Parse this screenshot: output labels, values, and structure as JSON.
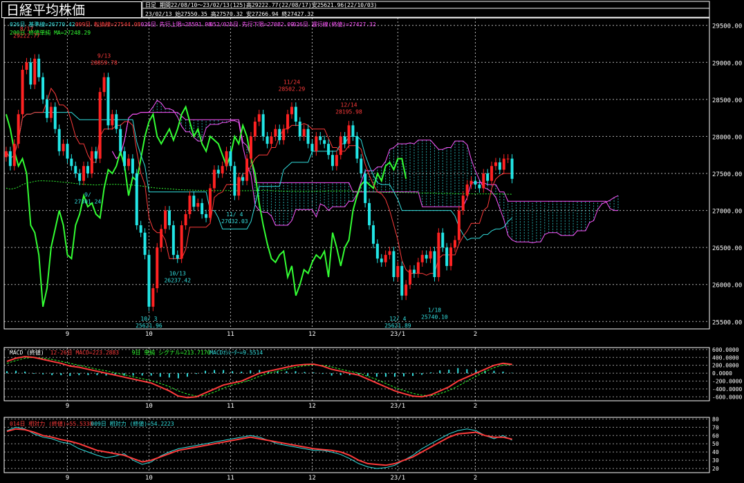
{
  "header": {
    "title": "日経平均株価",
    "line1": "日足  期間22/08/10～23/02/13(125)高29222.77(22/08/17)安25621.96(22/10/03)",
    "line2": "23/02/13      始27550.35 高27570.32 安27266.94 終27427.32"
  },
  "legend_main": [
    {
      "text": "026日 基準線=26770.42",
      "color": "#33e0e0"
    },
    {
      "text": "009日 転換線=27544.08",
      "color": "#ff3b3b"
    },
    {
      "text": "026日 先行上限=28591.98",
      "color": "#ff55ff"
    },
    {
      "text": "052/026日 先行下限=27082.09",
      "color": "#ff55ff"
    },
    {
      "text": "026日 遅行線(終値)=27427.32",
      "color": "#ff55ff"
    },
    {
      "text": "200日 終値単純 MA=27248.29",
      "color": "#33ff33"
    }
  ],
  "legend_macd": [
    {
      "text": "MACD (終値)",
      "color": "#ffffff"
    },
    {
      "text": "12-26日 MACD=223.2883",
      "color": "#ff3b3b"
    },
    {
      "text": "9日 単純 シグナル=213.7170",
      "color": "#33ff33"
    },
    {
      "text": "MACDｵｼﾚｰﾀｰ=9.5514",
      "color": "#33e0e0"
    }
  ],
  "legend_rsi": [
    {
      "text": "014日 相対力 (終値)=55.5338",
      "color": "#ff3b3b"
    },
    {
      "text": "009日 相対力 (終値)=54.2223",
      "color": "#33e0e0"
    }
  ],
  "x_labels": [
    {
      "label": "9",
      "idx": 15
    },
    {
      "label": "10",
      "idx": 35
    },
    {
      "label": "11",
      "idx": 55
    },
    {
      "label": "12",
      "idx": 75
    },
    {
      "label": "23/1",
      "idx": 96
    },
    {
      "label": "2",
      "idx": 115
    }
  ],
  "annotations": [
    {
      "label": "8/17",
      "value": "29222.77",
      "color": "#ff3b3b",
      "idx": 5,
      "price": 29222.77,
      "pos": "above"
    },
    {
      "label": "9/13",
      "value": "28859.78",
      "color": "#ff3b3b",
      "idx": 24,
      "price": 28859.78,
      "pos": "above"
    },
    {
      "label": "11/24",
      "value": "28502.29",
      "color": "#ff3b3b",
      "idx": 70,
      "price": 28502.29,
      "pos": "above"
    },
    {
      "label": "12/14",
      "value": "28195.98",
      "color": "#ff3b3b",
      "idx": 84,
      "price": 28195.98,
      "pos": "above"
    },
    {
      "label": "9/",
      "value": "27301.24",
      "color": "#33e0e0",
      "idx": 20,
      "price": 27301.24,
      "pos": "below"
    },
    {
      "label": "11/ 4",
      "value": "27032.03",
      "color": "#33e0e0",
      "idx": 56,
      "price": 27032.03,
      "pos": "below"
    },
    {
      "label": "10/13",
      "value": "26237.42",
      "color": "#33e0e0",
      "idx": 42,
      "price": 26237.42,
      "pos": "below"
    },
    {
      "label": "10/ 3",
      "value": "25621.96",
      "color": "#33e0e0",
      "idx": 35,
      "price": 25621.96,
      "pos": "below"
    },
    {
      "label": "12/ 4",
      "value": "25621.89",
      "color": "#33e0e0",
      "idx": 96,
      "price": 25621.89,
      "pos": "below"
    },
    {
      "label": "1/18",
      "value": "25740.10",
      "color": "#33e0e0",
      "idx": 105,
      "price": 25740.1,
      "pos": "below"
    }
  ],
  "chart_data": [
    {
      "type": "candlestick",
      "title": "日経平均株価",
      "ylim": [
        25400,
        29600
      ],
      "yticks": [
        25500,
        26000,
        26500,
        27000,
        27500,
        28000,
        28500,
        29000,
        29500
      ],
      "closes": [
        27800,
        27600,
        27900,
        28300,
        28900,
        29000,
        28700,
        29050,
        28800,
        28500,
        28250,
        28400,
        28100,
        27800,
        27900,
        27700,
        27600,
        27500,
        27400,
        27600,
        27500,
        27800,
        27700,
        28600,
        28800,
        28150,
        28300,
        28100,
        27800,
        27600,
        27700,
        27500,
        26800,
        26700,
        26400,
        25700,
        25950,
        26500,
        26750,
        27000,
        26800,
        26400,
        26350,
        26800,
        26950,
        27200,
        27050,
        27100,
        26950,
        26900,
        27300,
        27550,
        27500,
        27600,
        27800,
        27600,
        27200,
        27450,
        27400,
        27700,
        28000,
        28200,
        28300,
        28000,
        27900,
        28000,
        28100,
        27950,
        28100,
        28300,
        28400,
        28200,
        28000,
        28100,
        27900,
        27800,
        28000,
        27950,
        27900,
        27750,
        27600,
        27750,
        28000,
        27900,
        28150,
        28000,
        27700,
        27500,
        27100,
        26800,
        26550,
        26350,
        26300,
        26400,
        26450,
        26100,
        26250,
        25850,
        26000,
        26200,
        26150,
        26300,
        26400,
        26350,
        26450,
        26100,
        26700,
        26500,
        26250,
        26500,
        26600,
        27000,
        27200,
        27350,
        27400,
        27350,
        27300,
        27500,
        27400,
        27600,
        27650,
        27550,
        27700,
        27700,
        27427
      ]
    },
    {
      "type": "line",
      "title": "MACD (終値)",
      "ylim": [
        -700,
        650
      ],
      "yticks": [
        600,
        400,
        200,
        0,
        -200,
        -400,
        -600
      ],
      "ytick_labels": [
        "600.0000",
        "400.0000",
        "200.0000",
        "0.0000",
        "-200.0000",
        "-400.0000",
        "-600.0000"
      ],
      "series": [
        {
          "name": "12-26日 MACD",
          "values": [
            300,
            380,
            420,
            400,
            350,
            300,
            250,
            180,
            150,
            100,
            50,
            0,
            -50,
            -100,
            -150,
            -200,
            -250,
            -350,
            -450,
            -580,
            -620,
            -600,
            -500,
            -400,
            -300,
            -250,
            -200,
            -100,
            0,
            50,
            100,
            150,
            200,
            220,
            230,
            180,
            100,
            50,
            0,
            -50,
            -150,
            -250,
            -350,
            -450,
            -520,
            -580,
            -600,
            -550,
            -450,
            -350,
            -200,
            -100,
            0,
            100,
            200,
            250,
            223
          ]
        },
        {
          "name": "9日 単純 シグナル",
          "values": [
            250,
            320,
            380,
            400,
            380,
            350,
            300,
            250,
            200,
            150,
            100,
            60,
            10,
            -40,
            -90,
            -140,
            -190,
            -260,
            -340,
            -450,
            -530,
            -580,
            -560,
            -480,
            -380,
            -300,
            -240,
            -170,
            -80,
            0,
            50,
            100,
            150,
            190,
            210,
            200,
            160,
            100,
            50,
            0,
            -80,
            -160,
            -260,
            -360,
            -440,
            -510,
            -560,
            -570,
            -520,
            -440,
            -330,
            -200,
            -80,
            40,
            140,
            210,
            214
          ]
        },
        {
          "name": "MACDｵｼﾚｰﾀｰ",
          "values": [
            50,
            60,
            40,
            0,
            -30,
            -50,
            -50,
            -70,
            -50,
            -50,
            -50,
            -60,
            -60,
            -60,
            -60,
            -60,
            -60,
            -90,
            -110,
            -130,
            -90,
            -20,
            60,
            80,
            80,
            50,
            40,
            70,
            80,
            50,
            50,
            50,
            50,
            30,
            20,
            -20,
            -60,
            -50,
            -50,
            -50,
            -70,
            -90,
            -90,
            -90,
            -80,
            -70,
            -40,
            20,
            70,
            90,
            130,
            100,
            80,
            60,
            60,
            40,
            10
          ]
        }
      ]
    },
    {
      "type": "line",
      "title": "相対力",
      "ylim": [
        15,
        82
      ],
      "yticks": [
        80,
        70,
        60,
        50,
        40,
        30,
        20
      ],
      "series": [
        {
          "name": "014日 相対力 (終値)",
          "values": [
            65,
            68,
            67,
            64,
            60,
            58,
            55,
            53,
            50,
            46,
            42,
            40,
            38,
            36,
            32,
            28,
            30,
            34,
            38,
            42,
            44,
            46,
            48,
            50,
            52,
            54,
            56,
            58,
            56,
            54,
            52,
            50,
            48,
            46,
            44,
            43,
            42,
            40,
            36,
            30,
            26,
            25,
            24,
            26,
            30,
            34,
            40,
            46,
            52,
            58,
            62,
            63,
            64,
            60,
            58,
            58,
            55.5
          ]
        },
        {
          "name": "009日 相対力 (終値)",
          "values": [
            66,
            70,
            68,
            62,
            58,
            56,
            52,
            50,
            44,
            40,
            36,
            33,
            35,
            38,
            30,
            25,
            28,
            35,
            40,
            44,
            46,
            48,
            50,
            52,
            54,
            56,
            58,
            60,
            58,
            54,
            50,
            48,
            46,
            44,
            42,
            42,
            40,
            37,
            32,
            26,
            22,
            20,
            21,
            24,
            30,
            36,
            44,
            50,
            56,
            62,
            66,
            68,
            66,
            60,
            56,
            60,
            54.2
          ]
        }
      ]
    }
  ]
}
